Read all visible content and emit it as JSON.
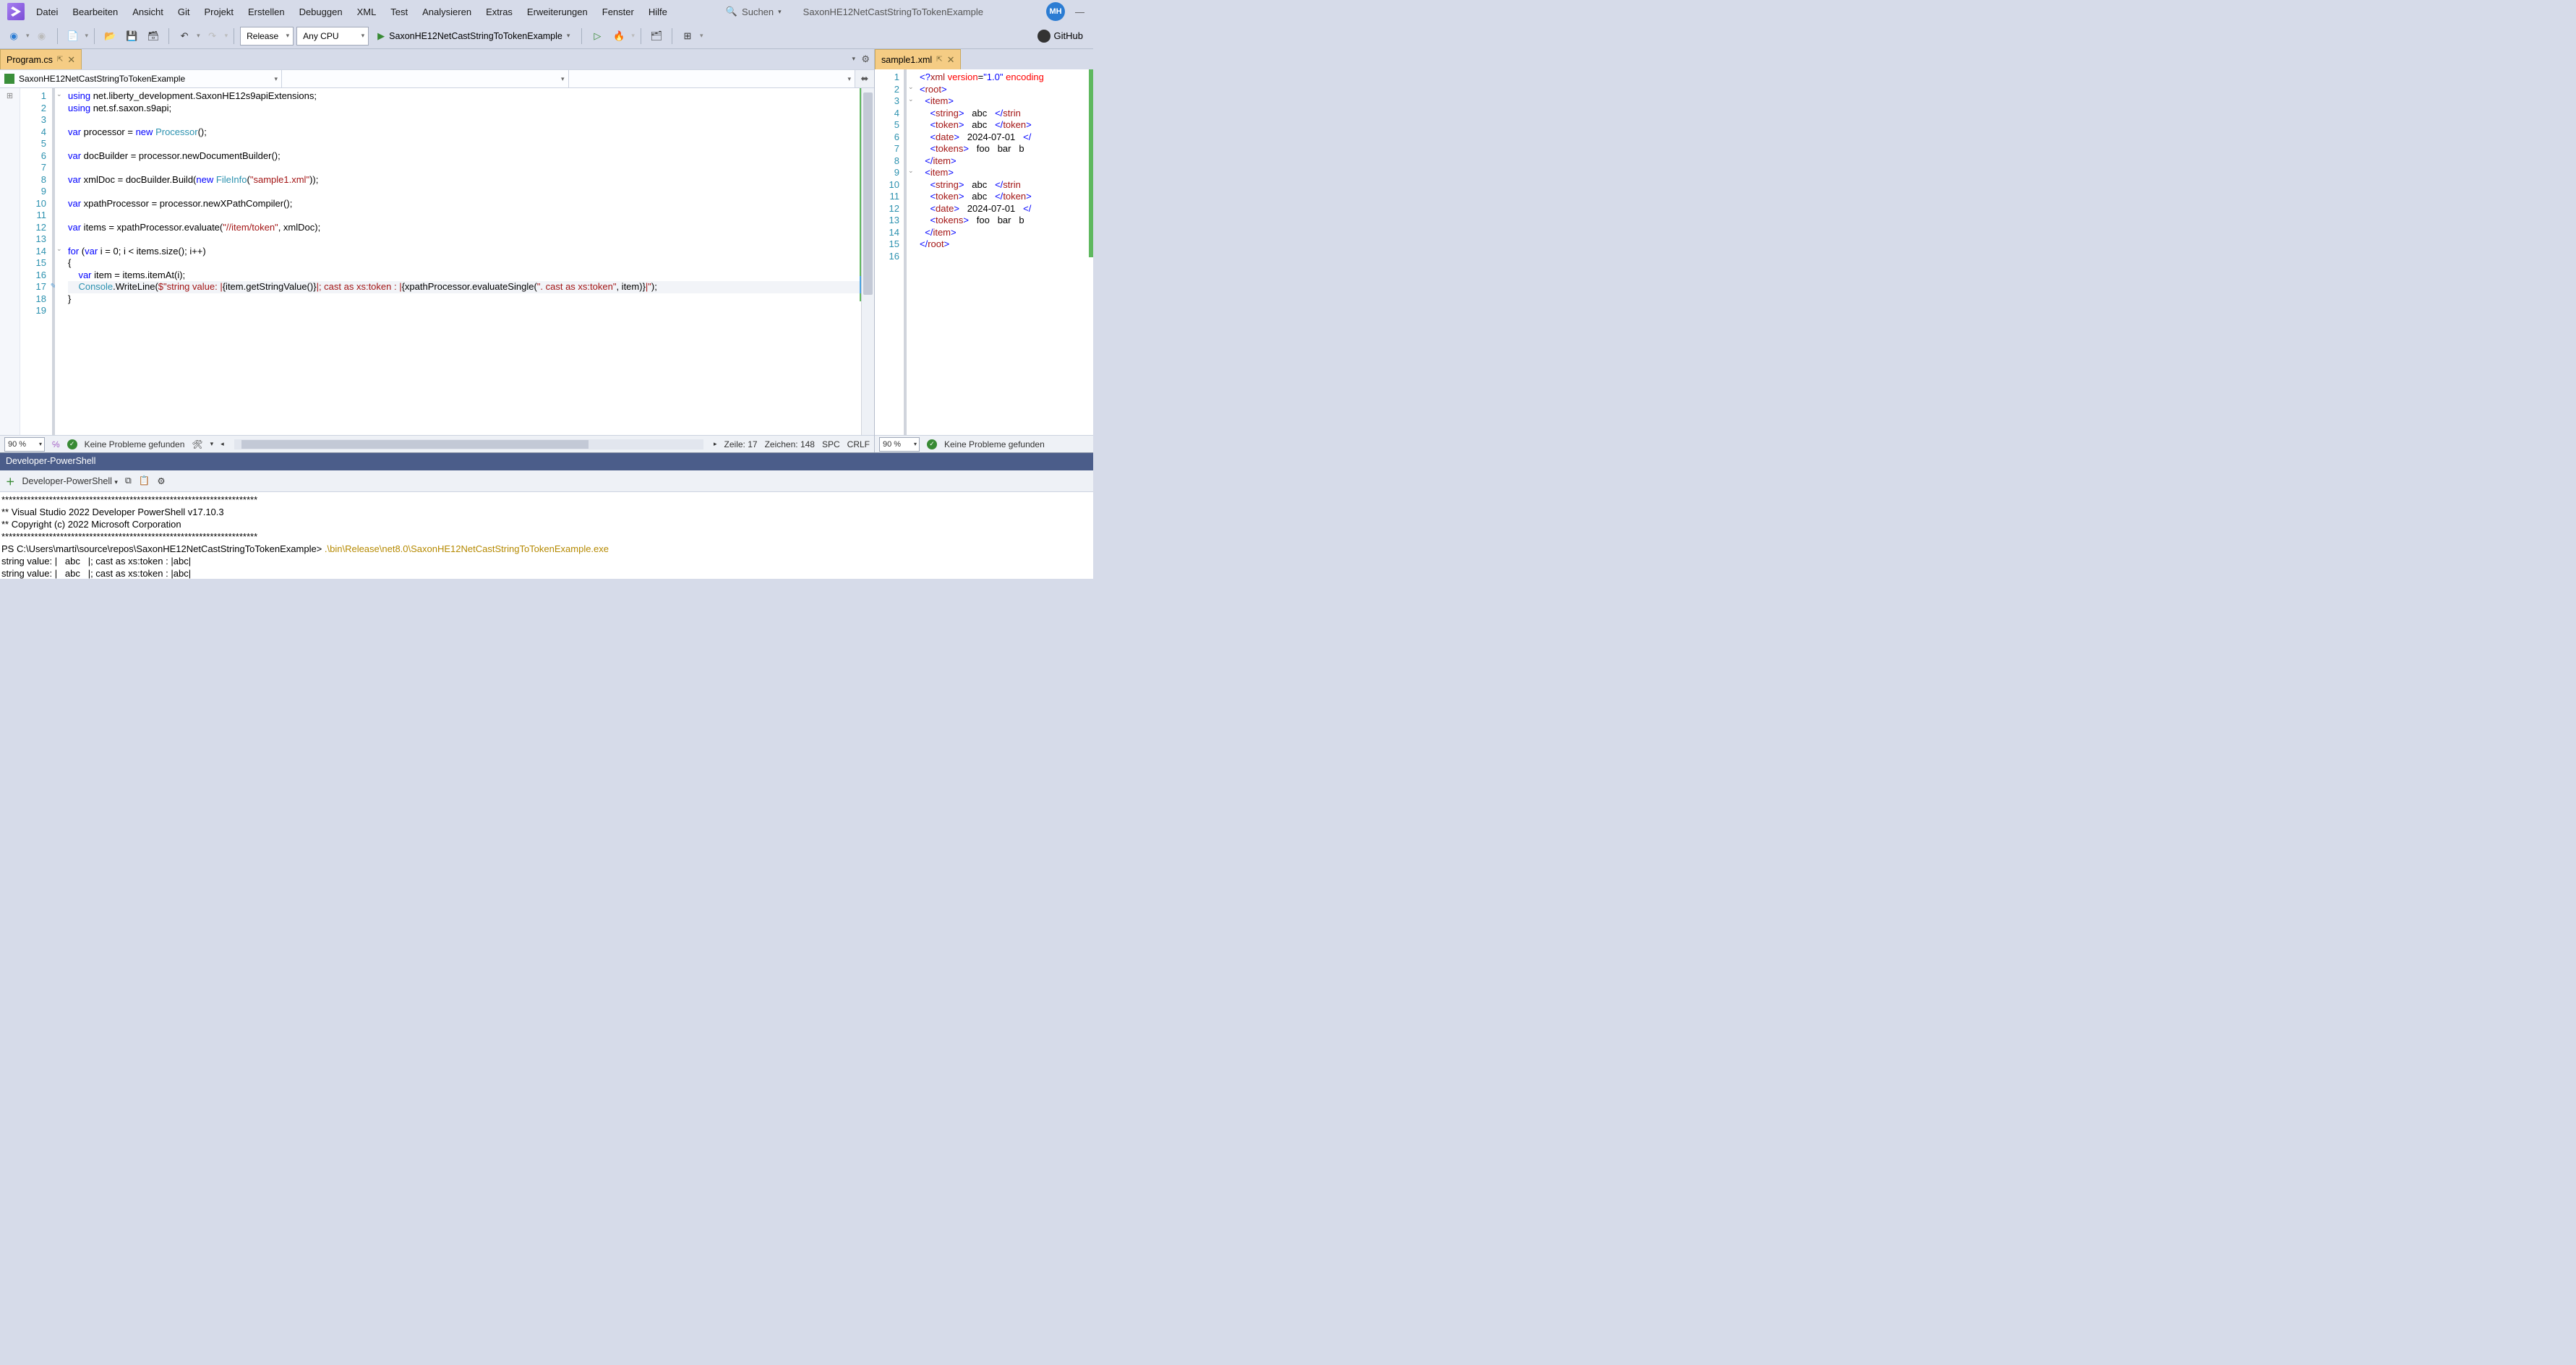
{
  "menubar": {
    "items": [
      "Datei",
      "Bearbeiten",
      "Ansicht",
      "Git",
      "Projekt",
      "Erstellen",
      "Debuggen",
      "XML",
      "Test",
      "Analysieren",
      "Extras",
      "Erweiterungen",
      "Fenster",
      "Hilfe"
    ],
    "search_label": "Suchen",
    "project_title": "SaxonHE12NetCastStringToTokenExample",
    "avatar": "MH"
  },
  "toolbar": {
    "config_combo": "Release",
    "platform_combo": "Any CPU",
    "start_target": "SaxonHE12NetCastStringToTokenExample",
    "github_label": "GitHub"
  },
  "left": {
    "tab": "Program.cs",
    "nav_project": "SaxonHE12NetCastStringToTokenExample",
    "lines": [
      {
        "n": 1,
        "html": "<span class='kw'>using</span> net.liberty_development.SaxonHE12s9apiExtensions;"
      },
      {
        "n": 2,
        "html": "<span class='kw'>using</span> net.sf.saxon.s9api;"
      },
      {
        "n": 3,
        "html": ""
      },
      {
        "n": 4,
        "html": "<span class='kw'>var</span> processor = <span class='kw'>new</span> <span class='typ'>Processor</span>();"
      },
      {
        "n": 5,
        "html": ""
      },
      {
        "n": 6,
        "html": "<span class='kw'>var</span> docBuilder = processor.newDocumentBuilder();"
      },
      {
        "n": 7,
        "html": ""
      },
      {
        "n": 8,
        "html": "<span class='kw'>var</span> xmlDoc = docBuilder.Build(<span class='kw'>new</span> <span class='typ'>FileInfo</span>(<span class='str'>\"sample1.xml\"</span>));"
      },
      {
        "n": 9,
        "html": ""
      },
      {
        "n": 10,
        "html": "<span class='kw'>var</span> xpathProcessor = processor.newXPathCompiler();"
      },
      {
        "n": 11,
        "html": ""
      },
      {
        "n": 12,
        "html": "<span class='kw'>var</span> items = xpathProcessor.evaluate(<span class='str'>\"//item/token\"</span>, xmlDoc);"
      },
      {
        "n": 13,
        "html": ""
      },
      {
        "n": 14,
        "html": "<span class='kw'>for</span> (<span class='kw'>var</span> i = 0; i &lt; items.size(); i++)"
      },
      {
        "n": 15,
        "html": "{"
      },
      {
        "n": 16,
        "html": "    <span class='kw'>var</span> item = items.itemAt(i);"
      },
      {
        "n": 17,
        "html": "    <span class='typ'>Console</span>.WriteLine(<span class='str'>$\"string value: |</span>{item.getStringValue()}<span class='str'>|; cast as xs:token : |</span>{xpathProcessor.evaluateSingle(<span class='str'>\". cast as xs:token\"</span>, item)}<span class='str'>|\"</span>);"
      },
      {
        "n": 18,
        "html": "}"
      },
      {
        "n": 19,
        "html": ""
      }
    ],
    "status": {
      "zoom": "90 %",
      "problems": "Keine Probleme gefunden",
      "line": "Zeile: 17",
      "col": "Zeichen: 148",
      "spc": "SPC",
      "crlf": "CRLF"
    }
  },
  "right": {
    "tab": "sample1.xml",
    "lines": [
      {
        "n": 1,
        "html": "<span class='pi'>&lt;?</span><span class='tag'>xml</span> <span class='attr'>version</span>=<span class='aval'>\"1.0\"</span> <span class='attr'>encoding</span>"
      },
      {
        "n": 2,
        "html": "<span class='pi'>&lt;</span><span class='tag'>root</span><span class='pi'>&gt;</span>"
      },
      {
        "n": 3,
        "html": "  <span class='pi'>&lt;</span><span class='tag'>item</span><span class='pi'>&gt;</span>"
      },
      {
        "n": 4,
        "html": "    <span class='pi'>&lt;</span><span class='tag'>string</span><span class='pi'>&gt;</span>   abc   <span class='pi'>&lt;/</span><span class='tag'>strin</span>"
      },
      {
        "n": 5,
        "html": "    <span class='pi'>&lt;</span><span class='tag'>token</span><span class='pi'>&gt;</span>   abc   <span class='pi'>&lt;/</span><span class='tag'>token</span><span class='pi'>&gt;</span>"
      },
      {
        "n": 6,
        "html": "    <span class='pi'>&lt;</span><span class='tag'>date</span><span class='pi'>&gt;</span>   2024-07-01   <span class='pi'>&lt;/</span>"
      },
      {
        "n": 7,
        "html": "    <span class='pi'>&lt;</span><span class='tag'>tokens</span><span class='pi'>&gt;</span>   foo   bar   b"
      },
      {
        "n": 8,
        "html": "  <span class='pi'>&lt;/</span><span class='tag'>item</span><span class='pi'>&gt;</span>"
      },
      {
        "n": 9,
        "html": "  <span class='pi'>&lt;</span><span class='tag'>item</span><span class='pi'>&gt;</span>"
      },
      {
        "n": 10,
        "html": "    <span class='pi'>&lt;</span><span class='tag'>string</span><span class='pi'>&gt;</span>   abc   <span class='pi'>&lt;/</span><span class='tag'>strin</span>"
      },
      {
        "n": 11,
        "html": "    <span class='pi'>&lt;</span><span class='tag'>token</span><span class='pi'>&gt;</span>   abc   <span class='pi'>&lt;/</span><span class='tag'>token</span><span class='pi'>&gt;</span>"
      },
      {
        "n": 12,
        "html": "    <span class='pi'>&lt;</span><span class='tag'>date</span><span class='pi'>&gt;</span>   2024-07-01   <span class='pi'>&lt;/</span>"
      },
      {
        "n": 13,
        "html": "    <span class='pi'>&lt;</span><span class='tag'>tokens</span><span class='pi'>&gt;</span>   foo   bar   b"
      },
      {
        "n": 14,
        "html": "  <span class='pi'>&lt;/</span><span class='tag'>item</span><span class='pi'>&gt;</span>"
      },
      {
        "n": 15,
        "html": "<span class='pi'>&lt;/</span><span class='tag'>root</span><span class='pi'>&gt;</span>"
      },
      {
        "n": 16,
        "html": ""
      }
    ],
    "status": {
      "zoom": "90 %",
      "problems": "Keine Probleme gefunden"
    }
  },
  "bottom": {
    "title": "Developer-PowerShell",
    "dropdown": "Developer-PowerShell",
    "terminal_lines": [
      "**********************************************************************",
      "** Visual Studio 2022 Developer PowerShell v17.10.3",
      "** Copyright (c) 2022 Microsoft Corporation",
      "**********************************************************************",
      {
        "prompt": "PS C:\\Users\\marti\\source\\repos\\SaxonHE12NetCastStringToTokenExample> ",
        "cmd": ".\\bin\\Release\\net8.0\\SaxonHE12NetCastStringToTokenExample.exe"
      },
      "string value: |   abc   |; cast as xs:token : |abc|",
      "string value: |   abc   |; cast as xs:token : |abc|"
    ]
  }
}
